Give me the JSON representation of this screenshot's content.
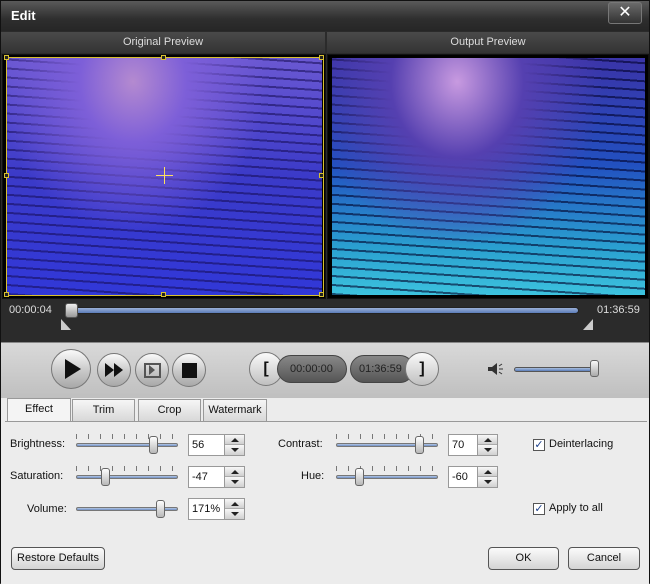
{
  "window": {
    "title": "Edit",
    "close_label": "✕"
  },
  "preview": {
    "original_label": "Original Preview",
    "output_label": "Output Preview"
  },
  "seek": {
    "current_time": "00:00:04",
    "end_time": "01:36:59",
    "position_fraction": 0.0
  },
  "playback": {
    "trim_start": "00:00:00",
    "trim_end": "01:36:59",
    "bracket_open": "[",
    "bracket_close": "]",
    "volume_fraction": 0.95,
    "icons": [
      "play-icon",
      "fast-forward-icon",
      "next-frame-icon",
      "stop-icon",
      "speaker-icon"
    ]
  },
  "tabs": [
    {
      "label": "Effect",
      "active": true
    },
    {
      "label": "Trim",
      "active": false
    },
    {
      "label": "Crop",
      "active": false
    },
    {
      "label": "Watermark",
      "active": false
    }
  ],
  "effect": {
    "brightness": {
      "label": "Brightness:",
      "value": "56",
      "fraction": 0.78
    },
    "saturation": {
      "label": "Saturation:",
      "value": "-47",
      "fraction": 0.27
    },
    "volume": {
      "label": "Volume:",
      "value": "171%",
      "fraction": 0.86
    },
    "contrast": {
      "label": "Contrast:",
      "value": "70",
      "fraction": 0.85
    },
    "hue": {
      "label": "Hue:",
      "value": "-60",
      "fraction": 0.2
    },
    "deinterlacing": {
      "label": "Deinterlacing",
      "checked": true
    },
    "apply_all": {
      "label": "Apply to all",
      "checked": true
    }
  },
  "buttons": {
    "restore": "Restore Defaults",
    "ok": "OK",
    "cancel": "Cancel"
  }
}
